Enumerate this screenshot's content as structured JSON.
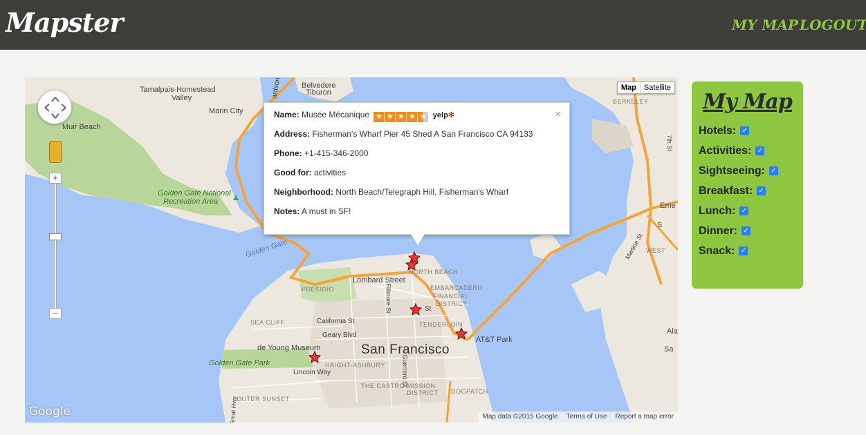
{
  "header": {
    "brand": "Mapster",
    "nav": [
      {
        "label": "MY MAP"
      },
      {
        "label": "LOGOUT"
      }
    ]
  },
  "map": {
    "type_toggle": {
      "map": "Map",
      "satellite": "Satellite",
      "active": "Map"
    },
    "labels": {
      "tamalpais": "Tamalpais-Homestead",
      "valley": "Valley",
      "belvedere": "Belvedere",
      "tiburon": "Tiburon",
      "marin_city": "Marin City",
      "muir_beach": "Muir Beach",
      "golden_gate_national": "Golden Gate National",
      "recreation_area": "Recreation Area",
      "golden_gate": "Golden Gate",
      "berkeley": "BERKELEY",
      "emery": "Eme",
      "lombard_street": "Lombard Street",
      "north_beach": "NORTH BEACH",
      "embarcadero": "EMBARCADERO",
      "financial_district": "FINANCIAL",
      "district": "DISTRICT",
      "presidio": "PRESIDIO",
      "sea_cliff": "SEA CLIFF",
      "california_st": "California St",
      "geary_blvd": "Geary Blvd",
      "tenderloin": "TENDERLOIN",
      "att_park": "AT&T Park",
      "de_young": "de Young Museum",
      "golden_gate_park": "Golden Gate Park",
      "haight": "HAIGHT-ASHBURY",
      "lincoln_way": "Lincoln Way",
      "san_francisco": "San Francisco",
      "castro": "THE CASTRO",
      "mission": "MISSION",
      "mission_district": "DISTRICT",
      "outer_sunset": "OUTER SUNSET",
      "dogpatch": "DOGPATCH",
      "great_hwy": "Great Hwy",
      "st": "St",
      "fillmore": "Fillmore St",
      "guerrero": "Guerrero St",
      "ala": "Ala",
      "seventh_st": "7th St",
      "martine": "Martine St",
      "west": "WEST",
      "ardson": "ardson",
      "sr": "S",
      "sa": "Sa"
    },
    "google_logo": "Google",
    "attribution": {
      "data": "Map data ©2015 Google",
      "terms": "Terms of Use",
      "report": "Report a map error"
    }
  },
  "infowindow": {
    "name_label": "Name:",
    "name": "Musée Mécanique",
    "rating": 4.5,
    "yelp": "yelp",
    "address_label": "Address:",
    "address": "Fisherman's Wharf Pier 45 Shed A San Francisco CA 94133",
    "phone_label": "Phone:",
    "phone": "+1-415-346-2000",
    "good_for_label": "Good for:",
    "good_for": "activities",
    "neighborhood_label": "Neighborhood:",
    "neighborhood": "North Beach/Telegraph Hill, Fisherman's Wharf",
    "notes_label": "Notes:",
    "notes": "A must in SF!",
    "close": "×"
  },
  "sidebar": {
    "title": "My Map",
    "filters": [
      {
        "label": "Hotels:",
        "checked": true
      },
      {
        "label": "Activities:",
        "checked": true
      },
      {
        "label": "Sightseeing:",
        "checked": true
      },
      {
        "label": "Breakfast:",
        "checked": true
      },
      {
        "label": "Lunch:",
        "checked": true
      },
      {
        "label": "Dinner:",
        "checked": true
      },
      {
        "label": "Snack:",
        "checked": true
      }
    ]
  },
  "colors": {
    "header_bg": "#3e3d38",
    "accent_green": "#8dc63f",
    "water": "#a6c6f7",
    "land": "#ece8df",
    "park": "#b9d69a",
    "highway": "#f6a33a",
    "checkbox_blue": "#2a7ff5"
  }
}
